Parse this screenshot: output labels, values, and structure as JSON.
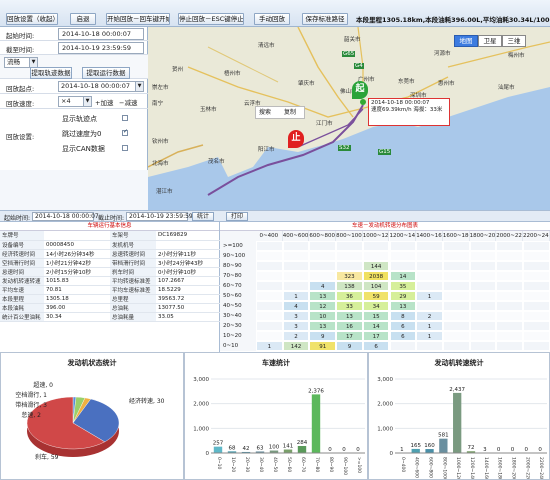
{
  "toolbar": {
    "buttons": [
      "回放设置（收起）",
      "启退",
      "开始回放－回车键开始",
      "停止回放－ESC键停止",
      "手动回放",
      "保存标准路径"
    ],
    "stats": "本段里程1305.18km,本段油耗396.00L,平均油耗30.34L/100km"
  },
  "panel": {
    "start_label": "起始时间:",
    "start_value": "2014-10-18 00:00:07",
    "end_label": "截至时间:",
    "end_value": "2014-10-19 23:59:59",
    "stream_select": "流畅",
    "fetch_track_button": "提取轨迹数据",
    "fetch_run_button": "提取运行数据",
    "start_point_label": "回放起点:",
    "start_point_value": "2014-10-18 00:00:07",
    "speed_label": "回放速度:",
    "speed_value": "×4",
    "speed_up": "加速",
    "speed_down": "减速",
    "settings_label": "回放设置:",
    "checkboxes": [
      {
        "label": "显示轨迹点",
        "checked": false
      },
      {
        "label": "跳过速度为0",
        "checked": true
      },
      {
        "label": "显示CAN数据",
        "checked": false
      }
    ]
  },
  "map": {
    "types": [
      "地图",
      "卫星",
      "三维"
    ],
    "tip_line1": "2014-10-18 00:00:07",
    "tip_line2": "速度69.39km/h 海拔：33米",
    "search_tab": "搜索",
    "copy_tab": "复制",
    "start_marker": "起",
    "stop_marker": "止",
    "cities": [
      {
        "name": "清远市"
      },
      {
        "name": "韶关市"
      },
      {
        "name": "河源市"
      },
      {
        "name": "梅州市"
      },
      {
        "name": "广州市"
      },
      {
        "name": "东莞市"
      },
      {
        "name": "惠州市"
      },
      {
        "name": "汕尾市"
      },
      {
        "name": "深圳市"
      },
      {
        "name": "香港"
      },
      {
        "name": "佛山市"
      },
      {
        "name": "肇庆市"
      },
      {
        "name": "江门市"
      },
      {
        "name": "阳江市"
      },
      {
        "name": "茂名市"
      },
      {
        "name": "云浮市"
      },
      {
        "name": "湛江市"
      },
      {
        "name": "玉林市"
      },
      {
        "name": "北海市"
      },
      {
        "name": "钦州市"
      },
      {
        "name": "南宁"
      },
      {
        "name": "梧州市"
      },
      {
        "name": "崇左市"
      },
      {
        "name": "贺州"
      }
    ],
    "road_labels": [
      "G65",
      "G4",
      "G15",
      "S32"
    ]
  },
  "timebar": {
    "start_label": "起始时间:",
    "start_value": "2014-10-18 00:00:07",
    "end_label": "截止时间:",
    "end_value": "2014-10-19 23:59:59",
    "stats_button": "统计",
    "print_button": "打印"
  },
  "info": {
    "title": "车辆运行基本信息",
    "rows": [
      [
        "车牌号",
        "",
        "车架号",
        "DC169829"
      ],
      [
        "设备编号",
        "00008450",
        "发机机号",
        ""
      ],
      [
        "经济转速时间",
        "14小时26分钟34秒",
        "怠速转速时间",
        "2小时分钟11秒"
      ],
      [
        "空挡滑行时间",
        "1小时21分钟42秒",
        "带档滑行时间",
        "3小时24分钟43秒"
      ],
      [
        "怠速时间",
        "2小时15分钟10秒",
        "刹车时间",
        "0小时分钟10秒"
      ],
      [
        "发动机转速转速",
        "1015.83",
        "平均转速标准差",
        "107.2667"
      ],
      [
        "平均车速",
        "70.81",
        "平均车速标准差",
        "18.5229"
      ],
      [
        "本段里程",
        "1305.18",
        "总里程",
        "39563.72"
      ],
      [
        "本段油耗",
        "396.00",
        "总油耗",
        "13077.50"
      ],
      [
        "统计百公里油耗",
        "30.34",
        "总油耗量",
        "33.05"
      ]
    ]
  },
  "matrix": {
    "title": "车速－发动机转速分布图表",
    "columns": [
      "0~400",
      "400~600",
      "600~800",
      "800~1000",
      "1000~1200",
      "1200~1400",
      "1400~1600",
      "1600~1800",
      "1800~2000",
      "2000~2200",
      "2200~2400"
    ],
    "rows": [
      {
        "label": ">=100",
        "cells": [
          "",
          "",
          "",
          "",
          "",
          "",
          "",
          "",
          "",
          "",
          ""
        ]
      },
      {
        "label": "90~100",
        "cells": [
          "",
          "",
          "",
          "",
          "",
          "",
          "",
          "",
          "",
          "",
          ""
        ]
      },
      {
        "label": "80~90",
        "cells": [
          "",
          "",
          "",
          "",
          "144",
          "",
          "",
          "",
          "",
          "",
          ""
        ]
      },
      {
        "label": "70~80",
        "cells": [
          "",
          "",
          "",
          "323",
          "2038",
          "14",
          "",
          "",
          "",
          "",
          ""
        ]
      },
      {
        "label": "60~70",
        "cells": [
          "",
          "",
          "4",
          "138",
          "104",
          "35",
          "",
          "",
          "",
          "",
          ""
        ]
      },
      {
        "label": "50~60",
        "cells": [
          "",
          "1",
          "13",
          "36",
          "59",
          "29",
          "1",
          "",
          "",
          "",
          ""
        ]
      },
      {
        "label": "40~50",
        "cells": [
          "",
          "4",
          "12",
          "33",
          "34",
          "13",
          "",
          "",
          "",
          "",
          ""
        ]
      },
      {
        "label": "30~40",
        "cells": [
          "",
          "3",
          "10",
          "13",
          "15",
          "8",
          "2",
          "",
          "",
          "",
          ""
        ]
      },
      {
        "label": "20~30",
        "cells": [
          "",
          "3",
          "13",
          "16",
          "14",
          "6",
          "1",
          "",
          "",
          "",
          ""
        ]
      },
      {
        "label": "10~20",
        "cells": [
          "",
          "2",
          "9",
          "17",
          "17",
          "6",
          "1",
          "",
          "",
          "",
          ""
        ]
      },
      {
        "label": "0~10",
        "cells": [
          "1",
          "142",
          "91",
          "9",
          "6",
          "",
          "",
          "",
          "",
          "",
          ""
        ]
      }
    ]
  },
  "pie": {
    "title": "发动机状态统计",
    "labels": [
      "超速, 0",
      "空档滑行, 1",
      "带档滑行, 3",
      "怠速, 2",
      "经济转速, 30",
      "刹车, 59"
    ]
  },
  "charts": [
    {
      "title": "车速统计",
      "yticks": [
        "3,000",
        "2,000",
        "1,000",
        "0"
      ],
      "values": [
        257,
        68,
        42,
        63,
        100,
        141,
        284,
        2376,
        0,
        0,
        0
      ],
      "labels": [
        "257",
        "68",
        "42",
        "63",
        "100",
        "141",
        "284",
        "2,376",
        "0",
        "0",
        "0"
      ],
      "xticks": [
        "0~10",
        "10~20",
        "20~30",
        "30~40",
        "40~50",
        "50~60",
        "60~70",
        "70~80",
        "80~90",
        "90~100",
        ">=100"
      ],
      "ymax": 3000
    },
    {
      "title": "发动机转速统计",
      "yticks": [
        "3,000",
        "2,000",
        "1,000",
        "0"
      ],
      "values": [
        1,
        165,
        160,
        581,
        2437,
        72,
        3,
        0,
        0,
        0,
        0
      ],
      "labels": [
        "1",
        "165",
        "160",
        "581",
        "2,437",
        "72",
        "3",
        "0",
        "0",
        "0",
        "0"
      ],
      "xticks": [
        "0~400",
        "400~600",
        "600~800",
        "800~1000",
        "1000~1200",
        "1200~1400",
        "1400~1600",
        "1600~1800",
        "1800~2000",
        "2000~2200",
        "2200~2400"
      ],
      "ymax": 3000
    }
  ],
  "chart_data": [
    {
      "type": "bar",
      "title": "车速统计",
      "categories": [
        "0~10",
        "10~20",
        "20~30",
        "30~40",
        "40~50",
        "50~60",
        "60~70",
        "70~80",
        "80~90",
        "90~100",
        ">=100"
      ],
      "values": [
        257,
        68,
        42,
        63,
        100,
        141,
        284,
        2376,
        0,
        0,
        0
      ],
      "ylim": [
        0,
        3000
      ]
    },
    {
      "type": "bar",
      "title": "发动机转速统计",
      "categories": [
        "0~400",
        "400~600",
        "600~800",
        "800~1000",
        "1000~1200",
        "1200~1400",
        "1400~1600",
        "1600~1800",
        "1800~2000",
        "2000~2200",
        "2200~2400"
      ],
      "values": [
        1,
        165,
        160,
        581,
        2437,
        72,
        3,
        0,
        0,
        0,
        0
      ],
      "ylim": [
        0,
        3000
      ]
    },
    {
      "type": "pie",
      "title": "发动机状态统计",
      "categories": [
        "超速",
        "空档滑行",
        "带档滑行",
        "怠速",
        "经济转速",
        "刹车"
      ],
      "values": [
        0,
        1,
        3,
        2,
        30,
        59
      ]
    }
  ]
}
